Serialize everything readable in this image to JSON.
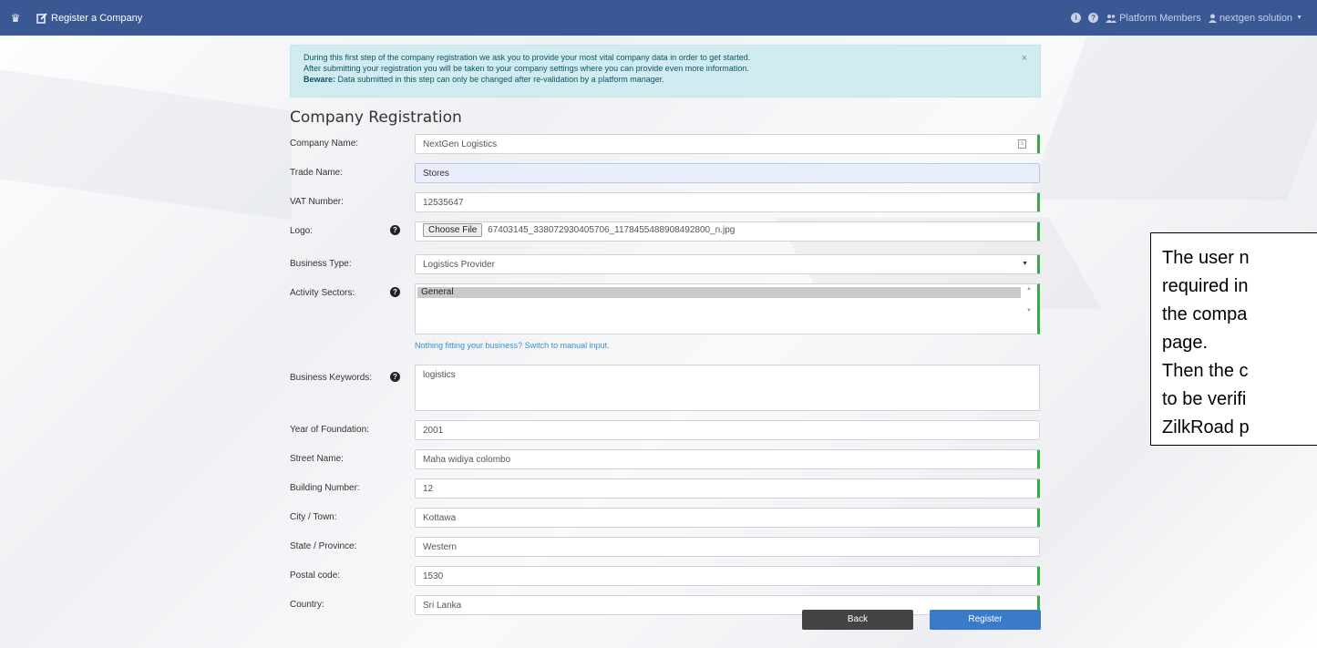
{
  "navbar": {
    "register_label": "Register a Company",
    "platform_members": "Platform Members",
    "user": "nextgen solution"
  },
  "alert": {
    "line1": "During this first step of the company registration we ask you to provide your most vital company data in order to get started.",
    "line2": "After submitting your registration you will be taken to your company settings where you can provide even more information.",
    "beware_label": "Beware:",
    "line3": " Data submitted in this step can only be changed after re-validation by a platform manager.",
    "close": "×"
  },
  "form": {
    "title": "Company Registration",
    "company_name": {
      "label": "Company Name:",
      "value": "NextGen Logistics"
    },
    "trade_name": {
      "label": "Trade Name:",
      "value": "Stores"
    },
    "vat_number": {
      "label": "VAT Number:",
      "value": "12535647"
    },
    "logo": {
      "label": "Logo:",
      "button": "Choose File",
      "file": "67403145_338072930405706_1178455488908492800_n.jpg"
    },
    "business_type": {
      "label": "Business Type:",
      "value": "Logistics Provider"
    },
    "activity_sectors": {
      "label": "Activity Sectors:",
      "option": "General",
      "manual_link": "Nothing fitting your business? Switch to manual input."
    },
    "business_keywords": {
      "label": "Business Keywords:",
      "value": "logistics"
    },
    "year_of_foundation": {
      "label": "Year of Foundation:",
      "value": "2001"
    },
    "street_name": {
      "label": "Street Name:",
      "value": "Maha widiya colombo"
    },
    "building_number": {
      "label": "Building Number:",
      "value": "12"
    },
    "city": {
      "label": "City / Town:",
      "value": "Kottawa"
    },
    "state": {
      "label": "State / Province:",
      "value": "Western"
    },
    "postal_code": {
      "label": "Postal code:",
      "value": "1530"
    },
    "country": {
      "label": "Country:",
      "value": "Sri Lanka"
    },
    "back_button": "Back",
    "register_button": "Register"
  },
  "note": {
    "text": "The user n\nrequired in\nthe compa\npage.\nThen the c\nto be verifi\nZilkRoad p\nto proceed"
  },
  "colors": {
    "navbar": "#3a5894",
    "alert_bg": "#d1ecf1",
    "valid_border": "#3aa845",
    "register_btn": "#3a7bc8",
    "back_btn": "#444444"
  }
}
